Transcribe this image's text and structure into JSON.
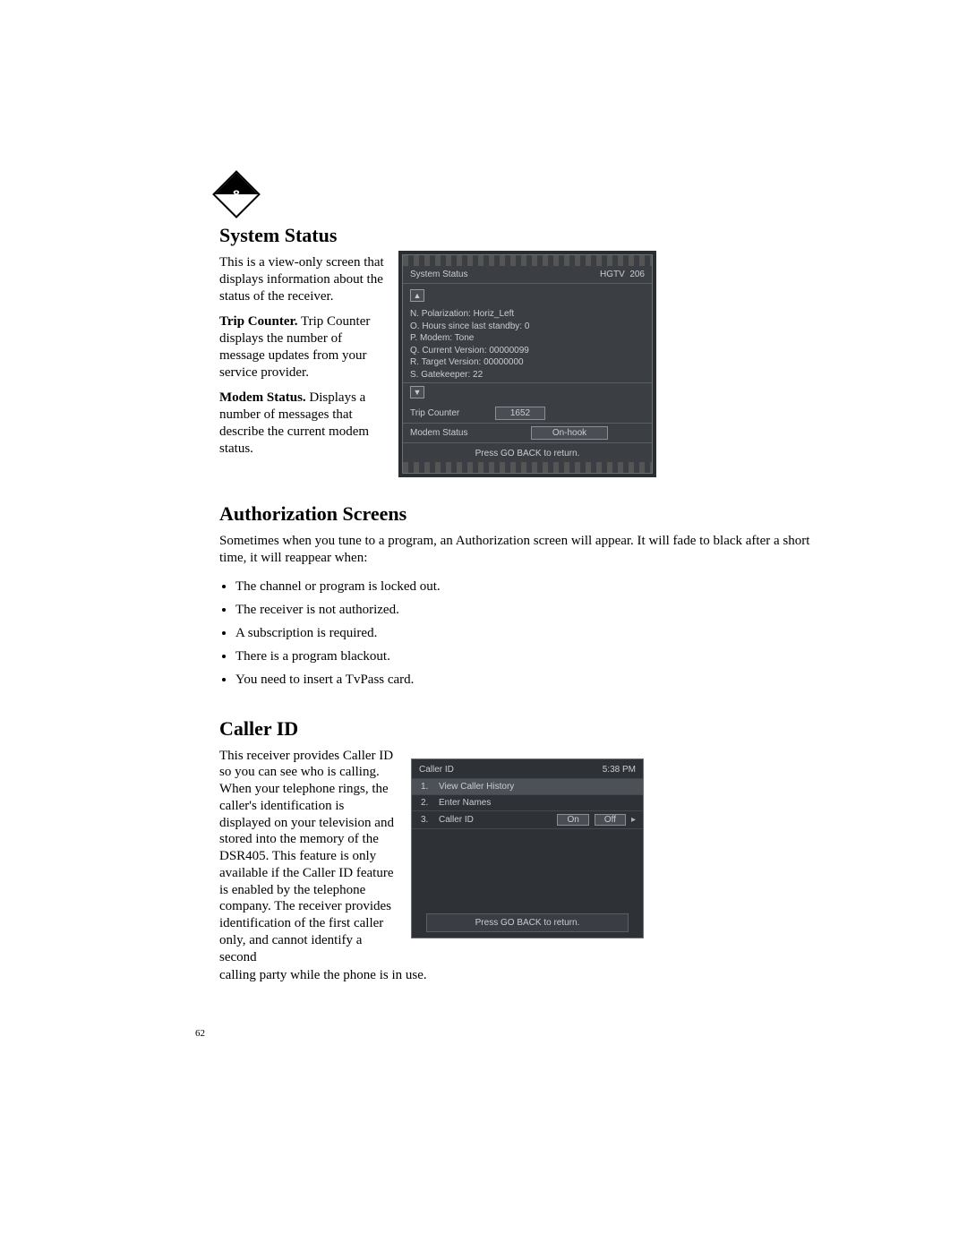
{
  "chapter_number": "8",
  "page_number": "62",
  "sections": {
    "system_status": {
      "title": "System Status",
      "para1": "This is a view-only screen that displays information about the status of the receiver.",
      "trip_lead": "Trip Counter.",
      "trip_body": " Trip Counter displays the number of message updates from your service provider.",
      "modem_lead": "Modem Status.",
      "modem_body": " Displays a number of messages that describe the current modem status."
    },
    "authorization": {
      "title": "Authorization Screens",
      "para1": "Sometimes when you tune to a program, an Authorization screen will appear. It will fade to black after a short time, it will reappear when:",
      "bullets": [
        "The channel or program is locked out.",
        "The receiver is not authorized.",
        "A subscription is required.",
        "There is a program blackout.",
        "You need to insert a TvPass card."
      ]
    },
    "caller_id": {
      "title": "Caller ID",
      "para1": "This receiver provides Caller ID so you can see who is calling. When your telephone rings, the caller's identification is displayed on your television and stored into the memory of the DSR405.  This feature is only available if the Caller ID feature is enabled by the telephone company.  The receiver provides identification of the first caller only, and cannot identify a second",
      "para_run": "calling party while the phone is in use."
    }
  },
  "sys_screen": {
    "title": "System Status",
    "channel_name": "HGTV",
    "channel_num": "206",
    "lines": [
      "N.  Polarization: Horiz_Left",
      "O.  Hours since last standby: 0",
      "P.  Modem: Tone",
      "Q.  Current Version: 00000099",
      "R.  Target Version: 00000000",
      "S.  Gatekeeper: 22"
    ],
    "trip_label": "Trip Counter",
    "trip_value": "1652",
    "modem_label": "Modem Status",
    "modem_value": "On-hook",
    "footer": "Press GO BACK to return."
  },
  "cid_screen": {
    "title": "Caller ID",
    "time": "5:38 PM",
    "items": [
      {
        "n": "1.",
        "text": "View Caller History"
      },
      {
        "n": "2.",
        "text": "Enter Names"
      },
      {
        "n": "3.",
        "text": "Caller ID"
      }
    ],
    "on": "On",
    "off": "Off",
    "footer": "Press GO BACK to return."
  }
}
